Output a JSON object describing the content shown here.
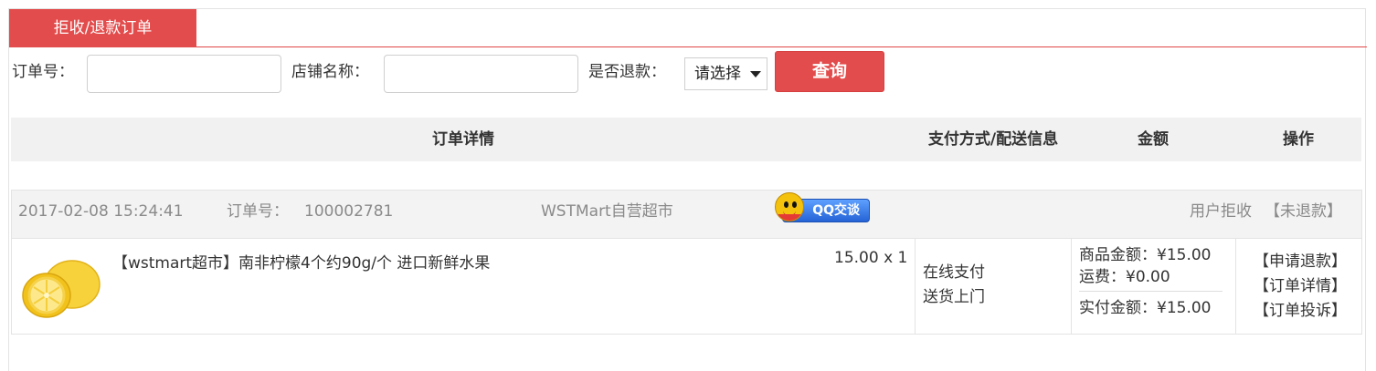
{
  "tab": {
    "label": "拒收/退款订单"
  },
  "search": {
    "order_no_label": "订单号：",
    "order_no_value": "",
    "shop_name_label": "店铺名称：",
    "shop_name_value": "",
    "refund_label": "是否退款：",
    "refund_select": "请选择",
    "query_button": "查询"
  },
  "table_header": {
    "detail": "订单详情",
    "pay_delivery": "支付方式/配送信息",
    "amount": "金额",
    "operation": "操作"
  },
  "order": {
    "time": "2017-02-08 15:24:41",
    "order_no_label": "订单号：",
    "order_no": "100002781",
    "shop": "WSTMart自营超市",
    "qq_label": "QQ交谈",
    "status": "用户拒收",
    "refund_status": "【未退款】",
    "goods": {
      "name": "【wstmart超市】南非柠檬4个约90g/个 进口新鲜水果",
      "price_qty": "15.00 x 1"
    },
    "payment": "在线支付",
    "delivery": "送货上门",
    "goods_amount": "商品金额：¥15.00",
    "freight": "运费：¥0.00",
    "paid_amount": "实付金额：¥15.00",
    "ops": [
      "【申请退款】",
      "【订单详情】",
      "【订单投诉】"
    ]
  },
  "colors": {
    "accent": "#e34c4c",
    "header_bg": "#f1f1f1",
    "muted_text": "#8a8a8a"
  }
}
